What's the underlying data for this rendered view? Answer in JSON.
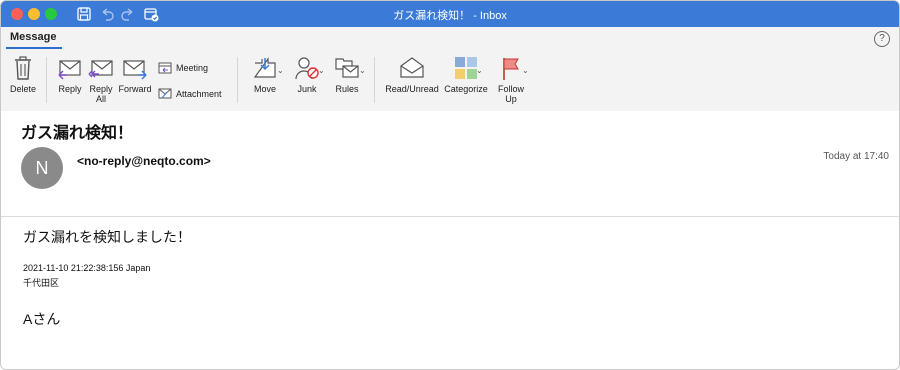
{
  "window": {
    "title": "ガス漏れ検知！ - Inbox",
    "tab": "Message",
    "help_label": "?"
  },
  "ribbon": {
    "delete": "Delete",
    "reply": "Reply",
    "reply_all_1": "Reply",
    "reply_all_2": "All",
    "forward": "Forward",
    "meeting": "Meeting",
    "attachment": "Attachment",
    "move": "Move",
    "junk": "Junk",
    "rules": "Rules",
    "read_unread": "Read/Unread",
    "categorize": "Categorize",
    "follow_up_1": "Follow",
    "follow_up_2": "Up"
  },
  "message": {
    "subject": "ガス漏れ検知！",
    "avatar_initial": "N",
    "sender": "<no-reply@neqto.com>",
    "time": "Today at 17:40"
  },
  "body": {
    "line1": "ガス漏れを検知しました！",
    "line2": "2021-11-10 21:22:38:156 Japan",
    "line3": "千代田区",
    "line4": "Aさん"
  },
  "colors": {
    "titlebar": "#3b7ad6",
    "accent": "#2b6fd1",
    "avatar": "#8a8a8a"
  }
}
